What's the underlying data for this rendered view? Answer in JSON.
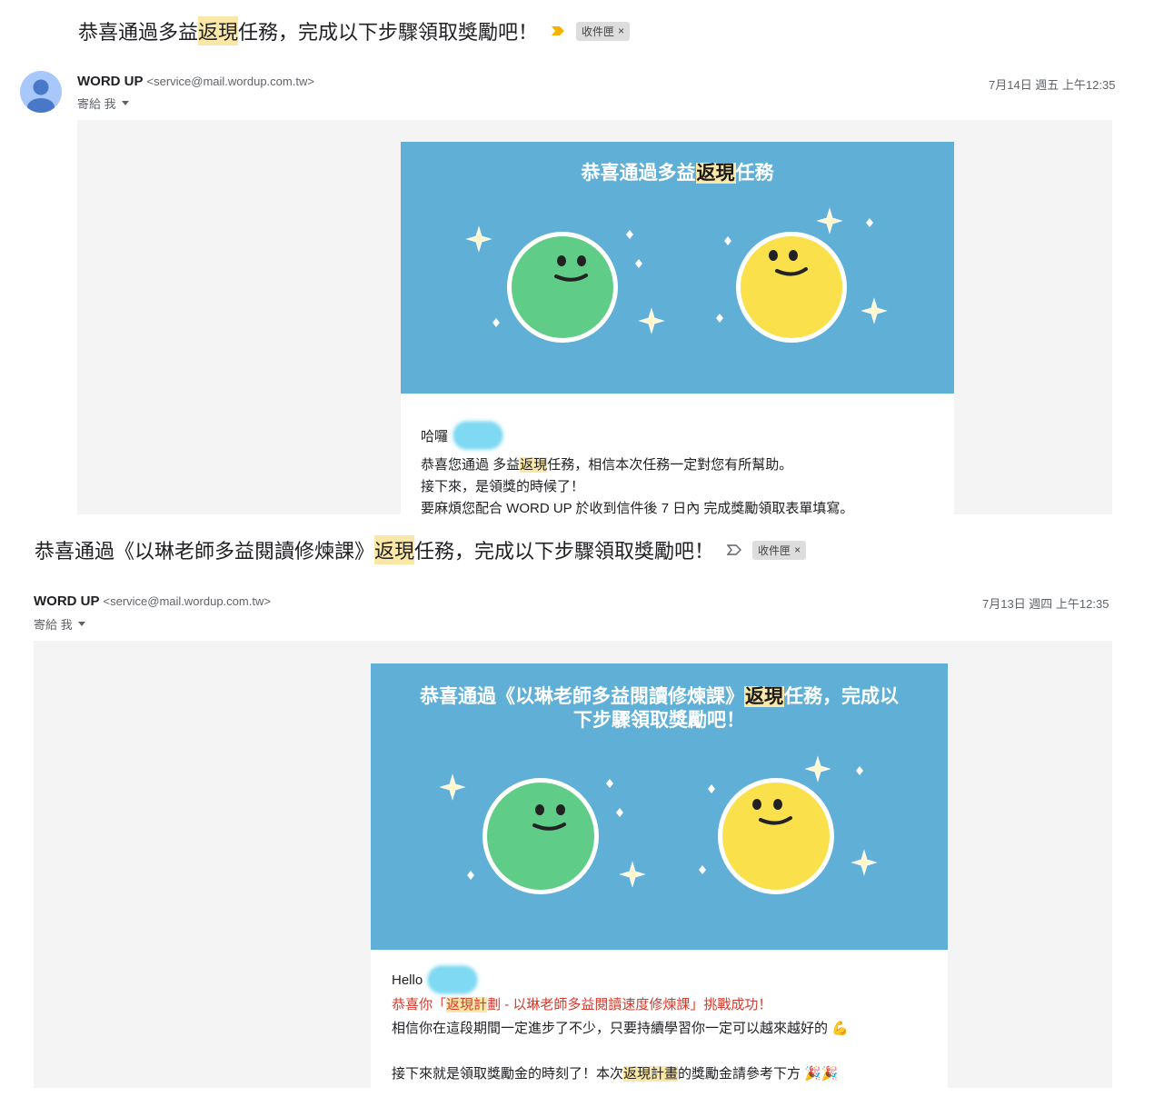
{
  "email1": {
    "subject_pre": "恭喜通過多益",
    "subject_hl": "返現",
    "subject_post": "任務，完成以下步驟領取獎勵吧！",
    "label": "收件匣",
    "label_close": "×",
    "sender_name": "WORD UP",
    "sender_email": "<service@mail.wordup.com.tw>",
    "to_text": "寄給 我",
    "date": "7月14日 週五 上午12:35",
    "banner_pre": "恭喜通過多益",
    "banner_hl": "返現",
    "banner_post": "任務",
    "greeting": "哈囉",
    "line1_pre": "恭喜您通過 多益",
    "line1_hl": "返現",
    "line1_post": "任務，相信本次任務一定對您有所幫助。",
    "line2": "接下來，是領獎的時候了！",
    "line3": "要麻煩您配合 WORD UP 於收到信件後 7 日內 完成獎勵領取表單填寫。"
  },
  "email2": {
    "subject_pre": "恭喜通過《以琳老師多益閱讀修煉課》",
    "subject_hl": "返現",
    "subject_post": "任務，完成以下步驟領取獎勵吧！",
    "label": "收件匣",
    "label_close": "×",
    "sender_name": "WORD UP",
    "sender_email": "<service@mail.wordup.com.tw>",
    "to_text": "寄給 我",
    "date": "7月13日 週四 上午12:35",
    "banner_line1_pre": "恭喜通過《以琳老師多益閱讀修煉課》",
    "banner_line1_hl": "返現",
    "banner_line1_post": "任務，完成以",
    "banner_line2": "下步驟領取獎勵吧！",
    "greeting": "Hello",
    "line1_pre": "恭喜你「",
    "line1_hl": "返現計",
    "line1_post": "劃 - 以琳老師多益閱讀速度修煉課」挑戰成功！",
    "line2": "相信你在這段期間一定進步了不少，只要持續學習你一定可以越來越好的 💪",
    "line3_pre": "接下來就是領取獎勵金的時刻了！本次",
    "line3_hl": "返現計畫",
    "line3_post": "的獎勵金請參考下方 🎉🎉"
  },
  "colors": {
    "banner_blue": "#5fafd7",
    "green_face": "#5fcc87",
    "yellow_face": "#fae04a",
    "highlight": "#fce8a6",
    "sparkle": "#fff7cc",
    "red_text": "#d23b2e"
  },
  "icons": {
    "importance": "importance-marker-icon",
    "avatar": "person-avatar-icon",
    "caret": "caret-down-icon"
  }
}
